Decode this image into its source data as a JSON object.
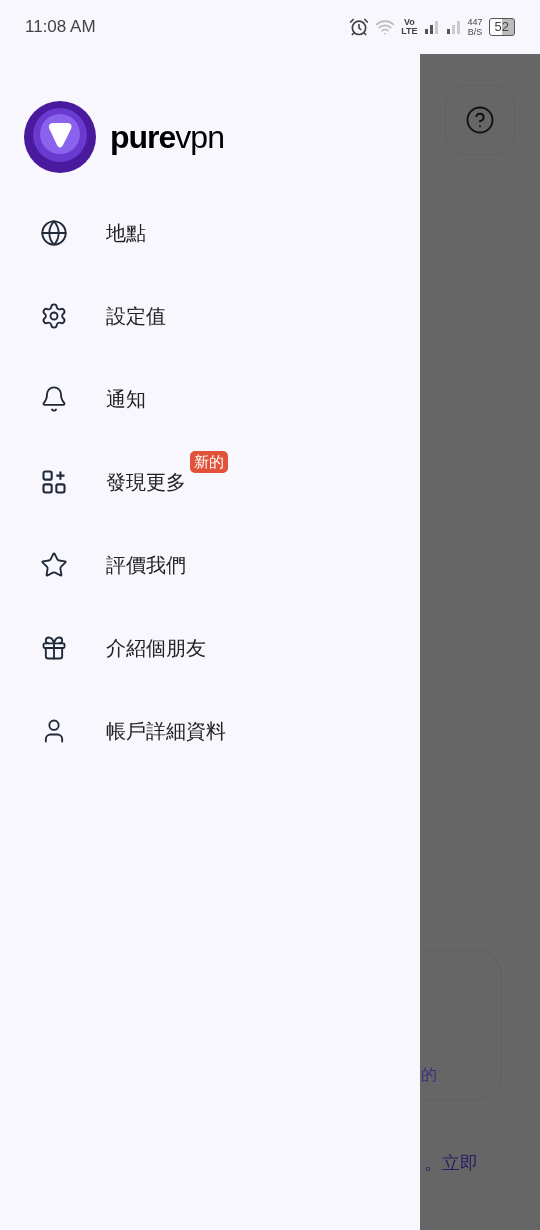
{
  "status_bar": {
    "time": "11:08 AM",
    "network_type": "Vo\nLTE",
    "speed": "447\nB/S",
    "battery": "52"
  },
  "drawer": {
    "brand": "purevpn",
    "items": [
      {
        "kind": "globe",
        "label": "地點"
      },
      {
        "kind": "settings",
        "label": "設定值"
      },
      {
        "kind": "bell",
        "label": "通知"
      },
      {
        "kind": "apps",
        "label": "發現更多",
        "badge": "新的"
      },
      {
        "kind": "star",
        "label": "評價我們"
      },
      {
        "kind": "gift",
        "label": "介紹個朋友"
      },
      {
        "kind": "user",
        "label": "帳戶詳細資料"
      }
    ]
  },
  "background": {
    "card_text": "的",
    "footer_text": "。立即"
  }
}
